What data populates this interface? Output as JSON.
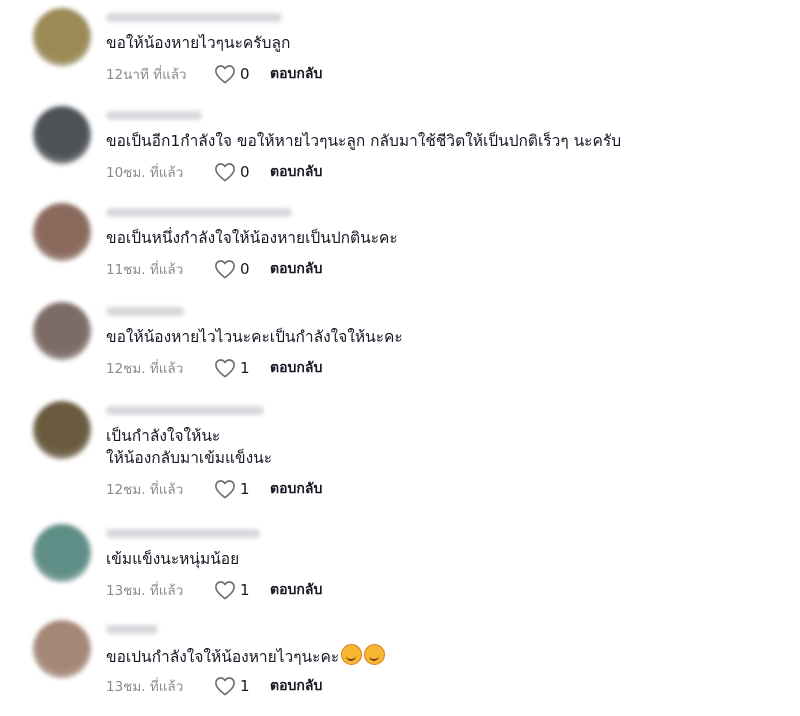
{
  "comments": [
    {
      "text_lines": [
        "ขอให้น้องหายไวๆนะครับลูก"
      ],
      "time": "12นาที ที่แล้ว",
      "likes": "0",
      "reply_label": "ตอบกลับ",
      "avatar_color": "#9a8a55",
      "has_emoji": false
    },
    {
      "text_lines": [
        "ขอเป็นอีก1กำลังใจ ขอให้หายไวๆนะลูก กลับมาใช้ชีวิตให้เป็นปกติเร็วๆ นะครับ"
      ],
      "time": "10ชม. ที่แล้ว",
      "likes": "0",
      "reply_label": "ตอบกลับ",
      "avatar_color": "#4d5257",
      "has_emoji": false
    },
    {
      "text_lines": [
        "ขอเป็นหนึ่งกำลังใจให้น้องหายเป็นปกตินะคะ"
      ],
      "time": "11ชม. ที่แล้ว",
      "likes": "0",
      "reply_label": "ตอบกลับ",
      "avatar_color": "#8b6a5d",
      "has_emoji": false
    },
    {
      "text_lines": [
        "ขอให้น้องหายไวไวนะคะเป็นกำลังใจให้นะคะ"
      ],
      "time": "12ชม. ที่แล้ว",
      "likes": "1",
      "reply_label": "ตอบกลับ",
      "avatar_color": "#7d6c66",
      "has_emoji": false
    },
    {
      "text_lines": [
        "เป็นกำลังใจให้นะ",
        "ให้น้องกลับมาเข้มแข็งนะ"
      ],
      "time": "12ชม. ที่แล้ว",
      "likes": "1",
      "reply_label": "ตอบกลับ",
      "avatar_color": "#6a5a3e",
      "has_emoji": false
    },
    {
      "text_lines": [
        "เข้มแข็งนะหนุ่มน้อย"
      ],
      "time": "13ชม. ที่แล้ว",
      "likes": "1",
      "reply_label": "ตอบกลับ",
      "avatar_color": "#5e8e86",
      "has_emoji": false
    },
    {
      "text_lines": [
        "ขอเปนกำลังใจให้น้องหายไวๆนะคะ"
      ],
      "time": "13ชม. ที่แล้ว",
      "likes": "1",
      "reply_label": "ตอบกลับ",
      "avatar_color": "#a58776",
      "has_emoji": true
    }
  ]
}
